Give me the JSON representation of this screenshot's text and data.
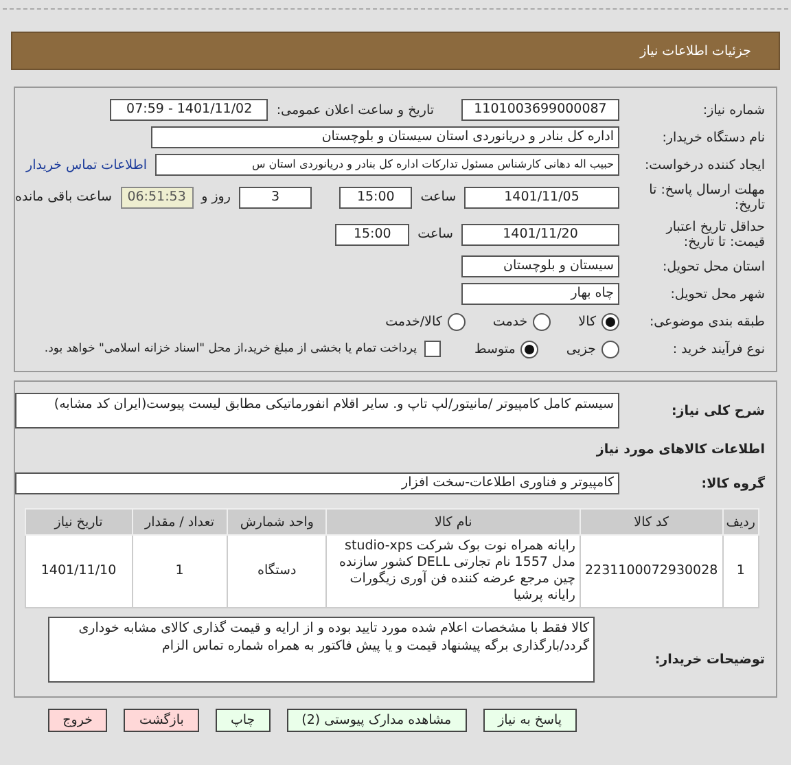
{
  "header": {
    "title": "جزئیات اطلاعات نیاز"
  },
  "need_number": {
    "label": "شماره نیاز:",
    "value": "1101003699000087"
  },
  "announce": {
    "label": "تاریخ و ساعت اعلان عمومی:",
    "value": "1401/11/02 - 07:59"
  },
  "buyer": {
    "label": "نام دستگاه خریدار:",
    "value": "اداره کل بنادر و دریانوردی استان سیستان و بلوچستان"
  },
  "creator": {
    "label": "ایجاد کننده درخواست:",
    "value": "حبیب اله دهانی کارشناس مسئول تدارکات اداره کل بنادر و دریانوردی استان س",
    "link": "اطلاعات تماس خریدار"
  },
  "deadline": {
    "label": "مهلت ارسال پاسخ: تا تاریخ:",
    "date": "1401/11/05",
    "time_label": "ساعت",
    "time": "15:00",
    "days": "3",
    "days_label": "روز و",
    "remaining": "06:51:53",
    "remaining_label": "ساعت باقی مانده"
  },
  "validity": {
    "label": "حداقل تاریخ اعتبار قیمت: تا تاریخ:",
    "date": "1401/11/20",
    "time_label": "ساعت",
    "time": "15:00"
  },
  "province": {
    "label": "استان محل تحویل:",
    "value": "سیستان و بلوچستان"
  },
  "city": {
    "label": "شهر محل تحویل:",
    "value": "چاه بهار"
  },
  "category": {
    "label": "طبقه بندی موضوعی:",
    "options": [
      {
        "label": "کالا",
        "selected": true
      },
      {
        "label": "خدمت",
        "selected": false
      },
      {
        "label": "کالا/خدمت",
        "selected": false
      }
    ]
  },
  "process": {
    "label": "نوع فرآیند خرید :",
    "options": [
      {
        "label": "جزیی",
        "selected": false
      },
      {
        "label": "متوسط",
        "selected": true
      }
    ],
    "treasury": {
      "label": "پرداخت تمام یا بخشی از مبلغ خرید،از محل \"اسناد خزانه اسلامی\" خواهد بود.",
      "checked": false
    }
  },
  "description": {
    "label": "شرح کلی نیاز:",
    "value": "سیستم کامل کامپیوتر /مانیتور/لپ تاپ و. سایر اقلام انفورماتیکی مطابق لیست پیوست(ایران کد مشابه)"
  },
  "goods_heading": "اطلاعات کالاهای مورد نیاز",
  "goods_group": {
    "label": "گروه کالا:",
    "value": "کامپیوتر و فناوری اطلاعات-سخت افزار"
  },
  "table": {
    "columns": [
      "ردیف",
      "کد کالا",
      "نام کالا",
      "واحد شمارش",
      "تعداد / مقدار",
      "تاریخ نیاز"
    ],
    "rows": [
      [
        "1",
        "2231100072930028",
        "رایانه همراه نوت بوک شرکت studio-xps مدل 1557 نام تجارتی DELL کشور سازنده چین مرجع عرضه کننده فن آوری زیگورات رایانه پرشیا",
        "دستگاه",
        "1",
        "1401/11/10"
      ]
    ]
  },
  "buyer_notes": {
    "label": "توضیحات خریدار:",
    "value": "کالا فقط با مشخصات اعلام شده مورد تایید بوده و از ارایه و قیمت گذاری کالای مشابه خوداری گردد/بارگذاری برگه پیشنهاد قیمت و یا پیش فاکتور به همراه شماره تماس الزام"
  },
  "buttons": [
    {
      "label": "پاسخ به نیاز",
      "kind": "normal"
    },
    {
      "label": "مشاهده مدارک پیوستی (2)",
      "kind": "normal"
    },
    {
      "label": "چاپ",
      "kind": "normal"
    },
    {
      "label": "بازگشت",
      "kind": "danger"
    },
    {
      "label": "خروج",
      "kind": "danger"
    }
  ]
}
